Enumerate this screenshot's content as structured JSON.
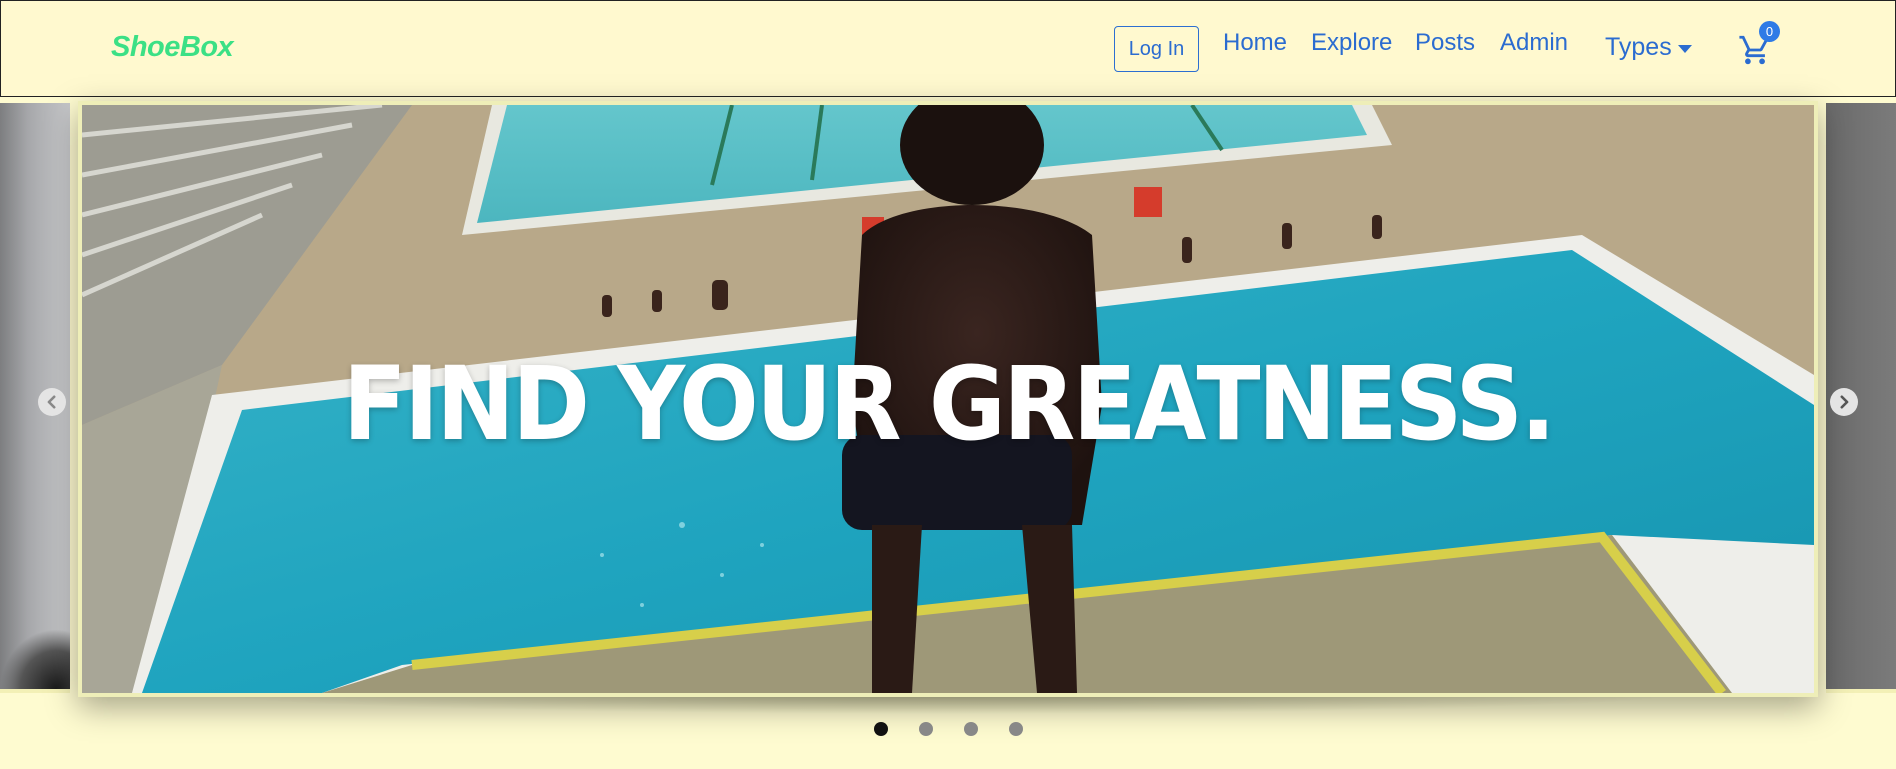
{
  "navbar": {
    "brand": "ShoeBox",
    "login_label": "Log In",
    "links": [
      "Home",
      "Explore",
      "Posts",
      "Admin"
    ],
    "types_label": "Types",
    "cart_count": "0"
  },
  "carousel": {
    "headline": "FIND YOUR GREATNESS.",
    "slide_count": 4,
    "active_index": 0,
    "prev_icon": "chevron-left-icon",
    "next_icon": "chevron-right-icon"
  },
  "colors": {
    "background": "#fefbd0",
    "brand": "#3be085",
    "link": "#2b6cd0",
    "badge": "#2e7be6"
  }
}
